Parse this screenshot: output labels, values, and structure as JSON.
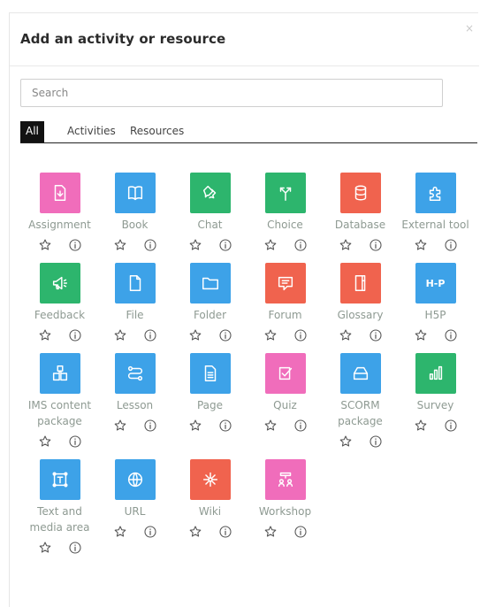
{
  "modal": {
    "title": "Add an activity or resource",
    "close_label": "×"
  },
  "search": {
    "placeholder": "Search",
    "value": ""
  },
  "tabs": [
    {
      "label": "All",
      "active": true
    },
    {
      "label": "Activities",
      "active": false
    },
    {
      "label": "Resources",
      "active": false
    }
  ],
  "items": [
    {
      "label": "Assignment",
      "color": "#f06dbb",
      "icon": "assignment-icon"
    },
    {
      "label": "Book",
      "color": "#3da2e8",
      "icon": "book-icon"
    },
    {
      "label": "Chat",
      "color": "#2db56d",
      "icon": "chat-icon"
    },
    {
      "label": "Choice",
      "color": "#2db56d",
      "icon": "choice-icon"
    },
    {
      "label": "Database",
      "color": "#f0634e",
      "icon": "database-icon"
    },
    {
      "label": "External tool",
      "color": "#3da2e8",
      "icon": "external-tool-icon"
    },
    {
      "label": "Feedback",
      "color": "#2db56d",
      "icon": "feedback-icon"
    },
    {
      "label": "File",
      "color": "#3da2e8",
      "icon": "file-icon"
    },
    {
      "label": "Folder",
      "color": "#3da2e8",
      "icon": "folder-icon"
    },
    {
      "label": "Forum",
      "color": "#f0634e",
      "icon": "forum-icon"
    },
    {
      "label": "Glossary",
      "color": "#f0634e",
      "icon": "glossary-icon"
    },
    {
      "label": "H5P",
      "color": "#3da2e8",
      "icon": "h5p-icon",
      "icon_text": "H-P"
    },
    {
      "label": "IMS content package",
      "color": "#3da2e8",
      "icon": "ims-package-icon"
    },
    {
      "label": "Lesson",
      "color": "#3da2e8",
      "icon": "lesson-icon"
    },
    {
      "label": "Page",
      "color": "#3da2e8",
      "icon": "page-icon"
    },
    {
      "label": "Quiz",
      "color": "#f06dbb",
      "icon": "quiz-icon"
    },
    {
      "label": "SCORM package",
      "color": "#3da2e8",
      "icon": "scorm-icon"
    },
    {
      "label": "Survey",
      "color": "#2db56d",
      "icon": "survey-icon"
    },
    {
      "label": "Text and media area",
      "color": "#3da2e8",
      "icon": "text-media-icon"
    },
    {
      "label": "URL",
      "color": "#3da2e8",
      "icon": "url-icon"
    },
    {
      "label": "Wiki",
      "color": "#f0634e",
      "icon": "wiki-icon"
    },
    {
      "label": "Workshop",
      "color": "#f06dbb",
      "icon": "workshop-icon"
    }
  ]
}
